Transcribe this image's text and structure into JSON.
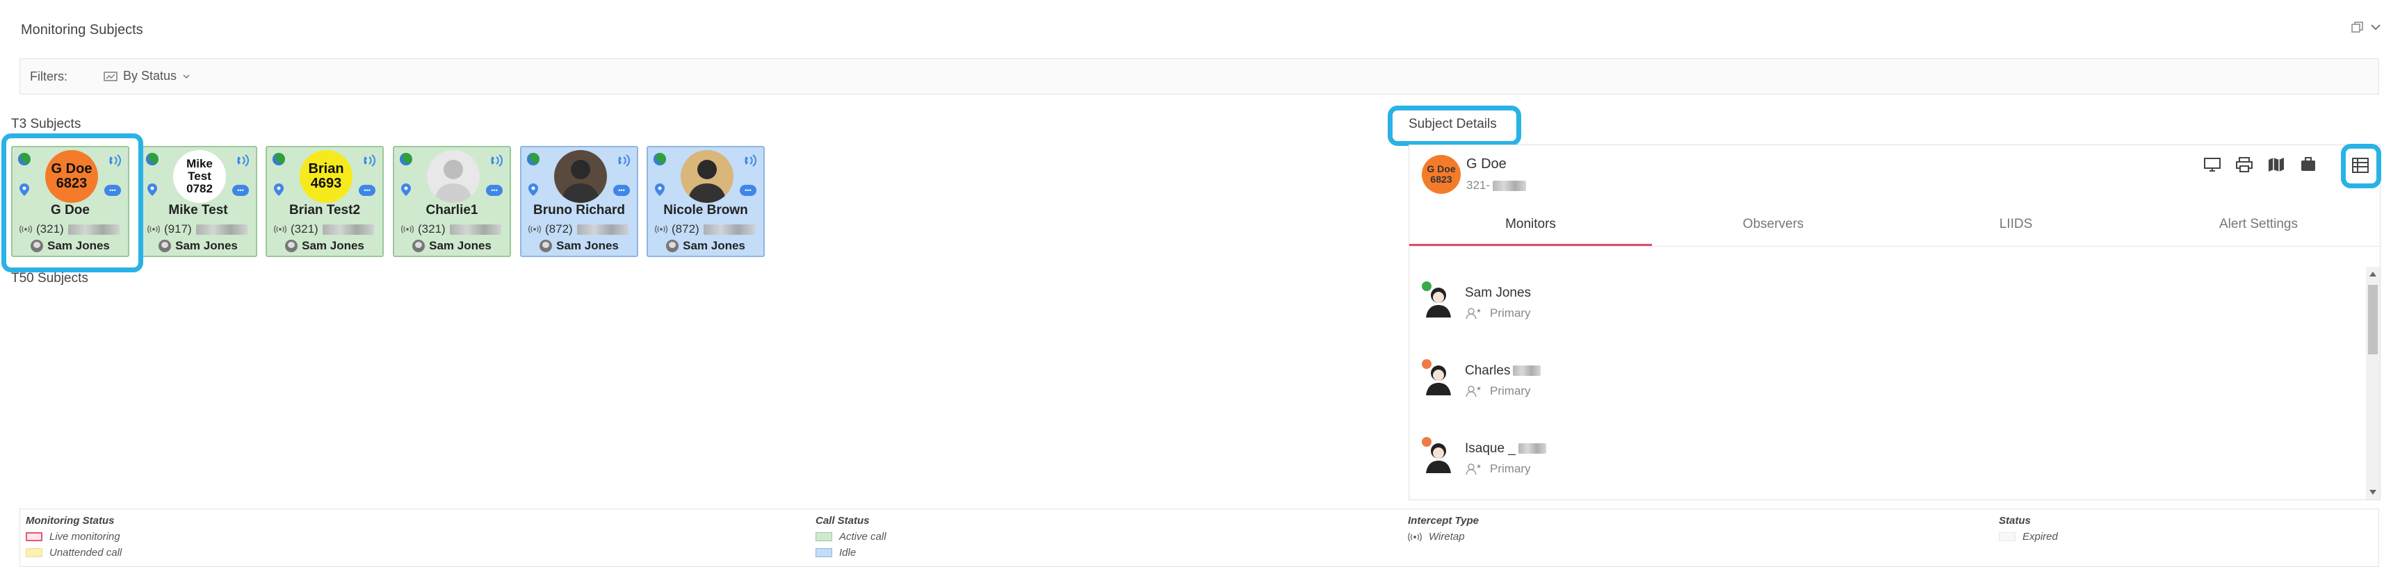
{
  "page": {
    "title": "Monitoring Subjects"
  },
  "filters": {
    "label": "Filters:",
    "by_status": "By Status"
  },
  "sections": {
    "t3": "T3 Subjects",
    "t50": "T50 Subjects",
    "details": "Subject Details"
  },
  "cards": [
    {
      "name": "G Doe",
      "phone_prefix": "(321)",
      "monitor": "Sam Jones",
      "avatar_text": "G Doe\n6823",
      "avatar_color": "#f47b2a",
      "status": "active"
    },
    {
      "name": "Mike Test",
      "phone_prefix": "(917)",
      "monitor": "Sam Jones",
      "avatar_text": "Mike Test\n0782",
      "avatar_color": "#ffffff",
      "status": "active"
    },
    {
      "name": "Brian Test2",
      "phone_prefix": "(321)",
      "monitor": "Sam Jones",
      "avatar_text": "Brian\n4693",
      "avatar_color": "#f6ea1c",
      "status": "active"
    },
    {
      "name": "Charlie1",
      "phone_prefix": "(321)",
      "monitor": "Sam Jones",
      "avatar_text": "",
      "avatar_color": "#e8e8e8",
      "status": "active"
    },
    {
      "name": "Bruno Richard",
      "phone_prefix": "(872)",
      "monitor": "Sam Jones",
      "avatar_text": "",
      "avatar_color": "#5a4a3e",
      "status": "idle"
    },
    {
      "name": "Nicole Brown",
      "phone_prefix": "(872)",
      "monitor": "Sam Jones",
      "avatar_text": "",
      "avatar_color": "#d9b77a",
      "status": "idle"
    }
  ],
  "details": {
    "subject_name": "G Doe",
    "subject_number": "321-",
    "avatar_text": "G Doe\n6823",
    "tabs": [
      "Monitors",
      "Observers",
      "LIIDS",
      "Alert Settings"
    ],
    "monitors": [
      {
        "name": "Sam Jones",
        "role": "Primary",
        "dot": "#3aa94a"
      },
      {
        "name": "Charles",
        "role": "Primary",
        "dot": "#f07a44"
      },
      {
        "name": "Isaque _",
        "role": "Primary",
        "dot": "#f07a44"
      }
    ]
  },
  "legend": {
    "monitoring_status": {
      "title": "Monitoring Status",
      "items": [
        "Live monitoring",
        "Unattended call"
      ]
    },
    "call_status": {
      "title": "Call Status",
      "items": [
        "Active call",
        "Idle"
      ]
    },
    "intercept_type": {
      "title": "Intercept Type",
      "items": [
        "Wiretap"
      ]
    },
    "status": {
      "title": "Status",
      "items": [
        "Expired"
      ]
    }
  },
  "colors": {
    "active_call": "#cfe9cf",
    "idle": "#c3dcf7",
    "highlight": "#29b2e6",
    "tab_accent": "#e24a6d"
  }
}
